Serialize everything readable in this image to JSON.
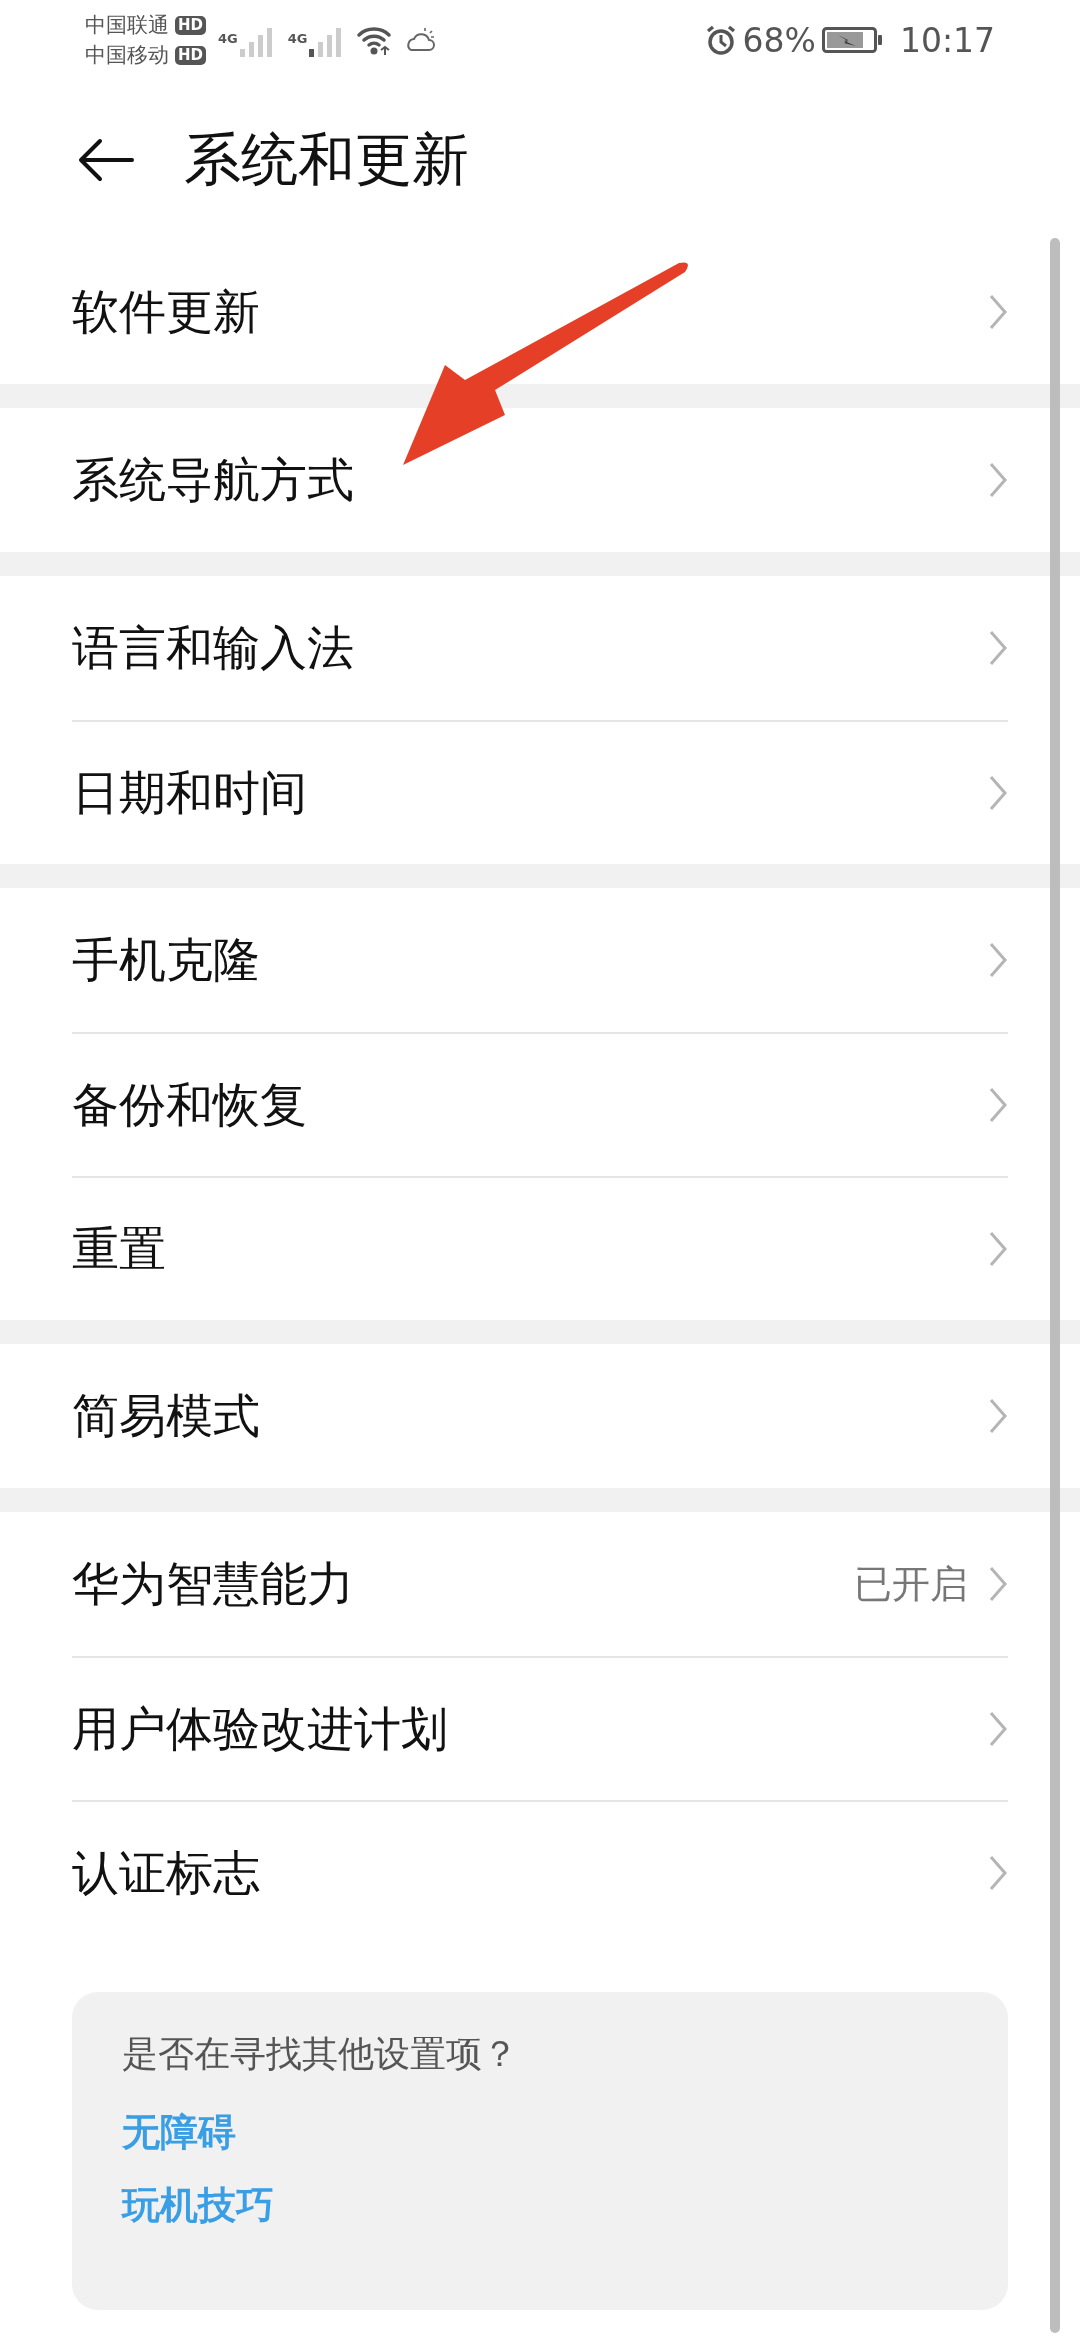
{
  "status_bar": {
    "carriers": [
      {
        "name": "中国联通",
        "badge": "HD"
      },
      {
        "name": "中国移动",
        "badge": "HD"
      }
    ],
    "networks": [
      "4G",
      "4G"
    ],
    "battery": "68%",
    "time": "10:17"
  },
  "header": {
    "title": "系统和更新"
  },
  "groups": [
    {
      "items": [
        {
          "label": "软件更新"
        }
      ]
    },
    {
      "items": [
        {
          "label": "系统导航方式"
        }
      ]
    },
    {
      "items": [
        {
          "label": "语言和输入法"
        },
        {
          "label": "日期和时间"
        }
      ]
    },
    {
      "items": [
        {
          "label": "手机克隆"
        },
        {
          "label": "备份和恢复"
        },
        {
          "label": "重置"
        }
      ]
    },
    {
      "items": [
        {
          "label": "简易模式"
        }
      ]
    },
    {
      "items": [
        {
          "label": "华为智慧能力",
          "value": "已开启"
        },
        {
          "label": "用户体验改进计划"
        },
        {
          "label": "认证标志"
        }
      ]
    }
  ],
  "suggestions": {
    "prompt": "是否在寻找其他设置项？",
    "links": [
      "无障碍",
      "玩机技巧"
    ]
  }
}
